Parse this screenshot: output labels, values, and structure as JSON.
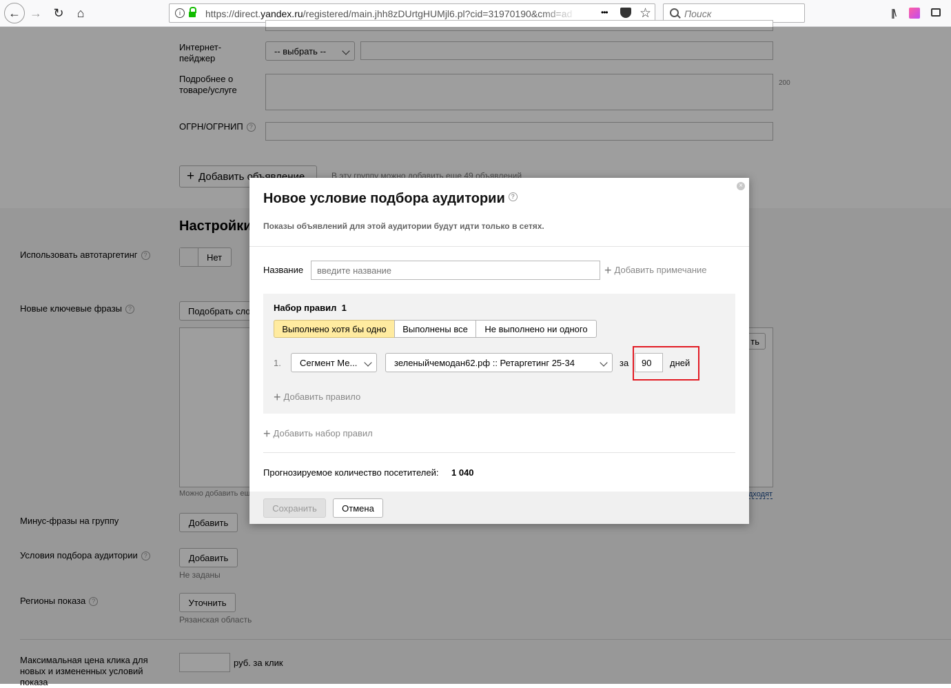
{
  "browser": {
    "url_prefix": "https://direct.",
    "url_domain": "yandex.ru",
    "url_rest": "/registered/main.jhh8zDUrtgHUMjl6.pl?cid=31970190&cmd=ad",
    "search_placeholder": "Поиск",
    "menu_dots": "•••"
  },
  "page": {
    "pager_label": "Интернет-\nпейджер",
    "pager_select": "-- выбрать --",
    "details_label": "Подробнее о\nтоваре/услуге",
    "details_counter": "200",
    "ogrn_label": "ОГРН/ОГРНИП",
    "add_ad_button": "Добавить объявление",
    "add_ad_note": "В эту группу можно добавить еще 49 объявлений",
    "settings_heading": "Настройки",
    "autotargeting_label": "Использовать автотаргетинг",
    "autotargeting_value": "Нет",
    "keywords_label": "Новые ключевые фразы",
    "keywords_button": "Подобрать слова",
    "keywords_note": "Можно добавить еще",
    "keywords_right_btn": "ть",
    "keywords_right_link": "дходят",
    "minus_label": "Минус-фразы на группу",
    "minus_button": "Добавить",
    "audience_label": "Условия подбора аудитории",
    "audience_button": "Добавить",
    "audience_note": "Не заданы",
    "regions_label": "Регионы показа",
    "regions_button": "Уточнить",
    "regions_note": "Рязанская область",
    "maxprice_label": "Максимальная цена клика для новых и измененных условий показа",
    "maxprice_unit": "руб. за клик"
  },
  "modal": {
    "title": "Новое условие подбора аудитории",
    "subtitle": "Показы объявлений для этой аудитории будут идти только в сетях.",
    "name_label": "Название",
    "name_placeholder": "введите название",
    "add_note": "Добавить примечание",
    "ruleset_title": "Набор правил  1",
    "modes": [
      "Выполнено хотя бы одно",
      "Выполнены все",
      "Не выполнено ни одного"
    ],
    "rule_index": "1.",
    "rule_type": "Сегмент Ме...",
    "rule_segment": "зеленыйчемодан62.рф :: Ретаргетинг 25-34",
    "for_label": "за",
    "days_value": "90",
    "days_label": "дней",
    "add_rule": "Добавить правило",
    "add_ruleset": "Добавить набор правил",
    "forecast_label": "Прогнозируемое количество посетителей:",
    "forecast_value": "1 040",
    "save_button": "Сохранить",
    "cancel_button": "Отмена"
  }
}
